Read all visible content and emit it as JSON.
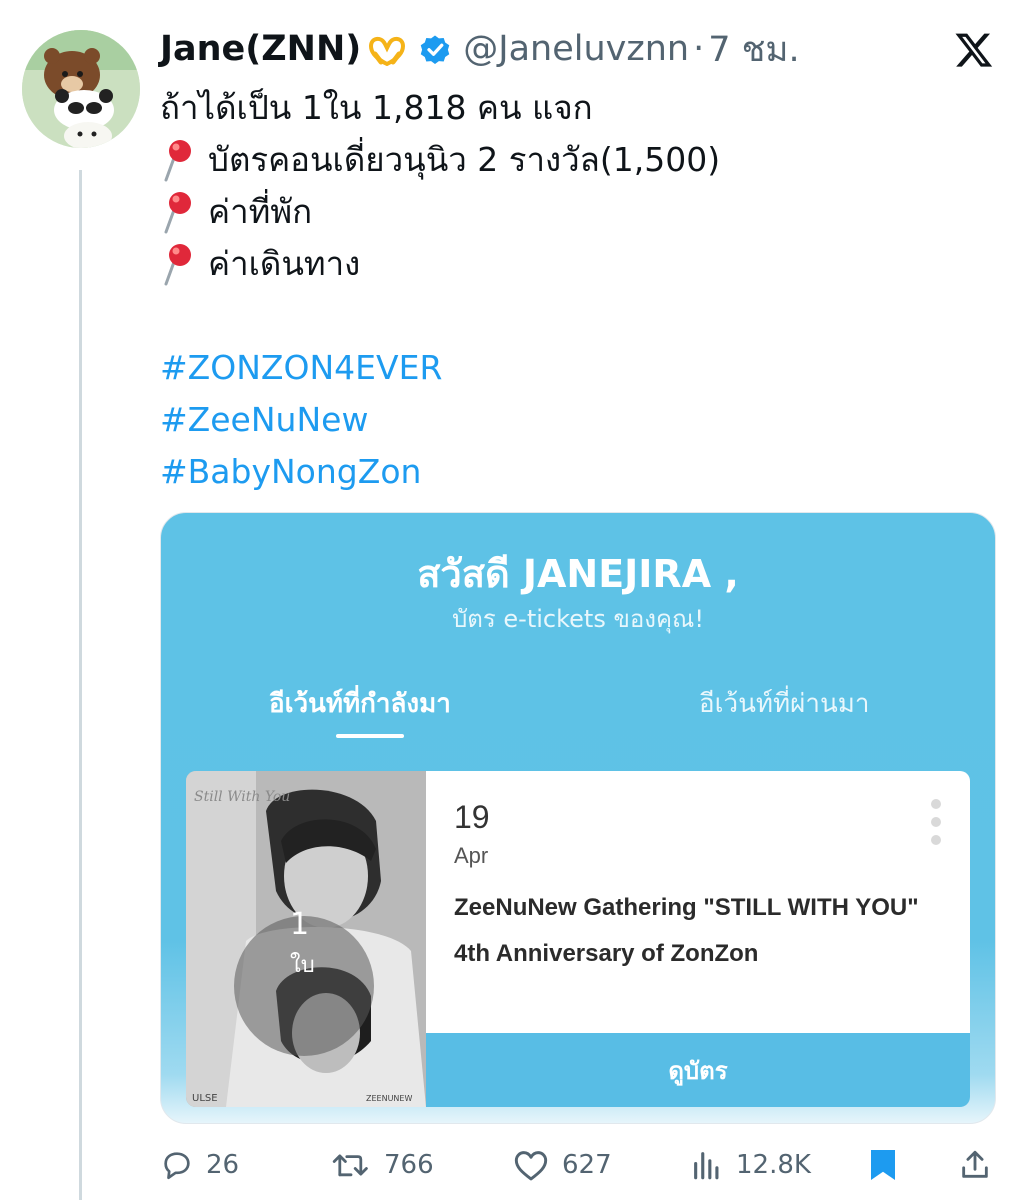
{
  "author": {
    "display_name": "Jane(ZNN)",
    "name_emoji": "heart-hands-emoji",
    "handle": "@Janeluvznn",
    "separator": "·",
    "time": "7 ชม.",
    "verified_color": "#1d9bf0"
  },
  "tweet": {
    "lines": [
      "ถ้าได้เป็น 1ใน 1,818 คน แจก",
      "บัตรคอนเดี่ยวนุนิว 2 รางวัล(1,500)",
      "ค่าที่พัก",
      "ค่าเดินทาง"
    ],
    "hashtags": [
      "#ZONZON4EVER",
      "#ZeeNuNew",
      "#BabyNongZon"
    ]
  },
  "card": {
    "greeting": "สวัสดี JANEJIRA ,",
    "subtitle": "บัตร e-tickets ของคุณ!",
    "tabs": {
      "upcoming": "อีเว้นท์ที่กำลังมา",
      "past": "อีเว้นท์ที่ผ่านมา"
    },
    "event": {
      "day": "19",
      "month": "Apr",
      "title": "ZeeNuNew Gathering \"STILL WITH YOU\" 4th Anniversary of ZonZon",
      "ticket_count": "1",
      "ticket_unit": "ใบ",
      "view_button": "ดูบัตร"
    },
    "accent_color": "#5ec2e6"
  },
  "actions": {
    "replies": "26",
    "reposts": "766",
    "likes": "627",
    "views": "12.8K",
    "bookmark_color": "#1d9bf0"
  }
}
